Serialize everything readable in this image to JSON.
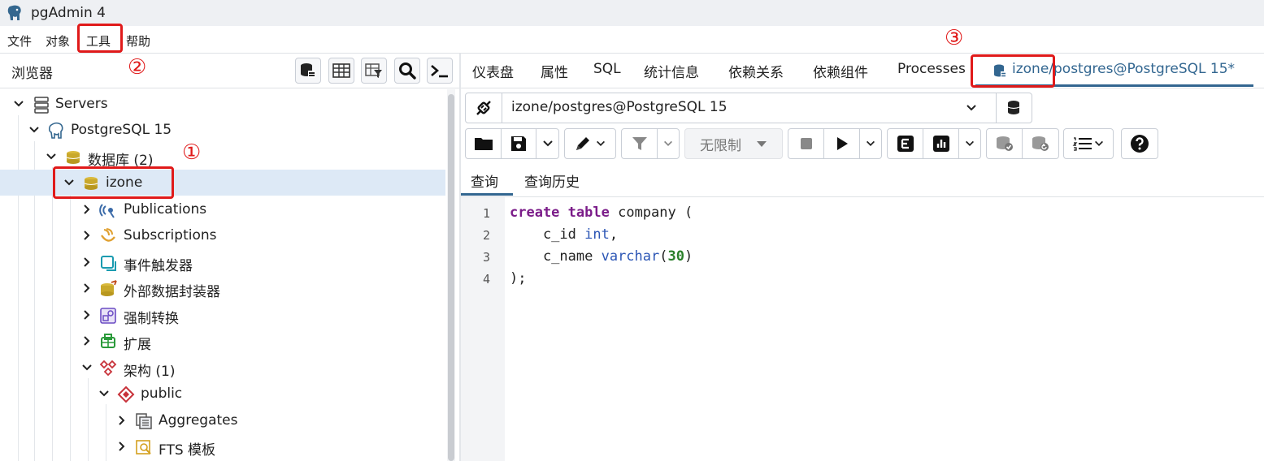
{
  "window": {
    "title": "pgAdmin 4"
  },
  "menu": [
    "文件",
    "对象",
    "工具",
    "帮助"
  ],
  "browser": {
    "title": "浏览器",
    "toolbar_icons": [
      "query-tool-icon",
      "table-view-icon",
      "filtered-rows-icon",
      "search-icon",
      "psql-terminal-icon"
    ]
  },
  "tree": [
    {
      "label": "Servers",
      "icon": "servers-icon"
    },
    {
      "label": "PostgreSQL 15",
      "icon": "elephant-icon"
    },
    {
      "label": "数据库 (2)",
      "icon": "databases-icon"
    },
    {
      "label": "izone",
      "icon": "database-icon",
      "selected": true
    },
    {
      "label": "Publications",
      "icon": "publication-icon"
    },
    {
      "label": "Subscriptions",
      "icon": "subscription-icon"
    },
    {
      "label": "事件触发器",
      "icon": "event-trigger-icon"
    },
    {
      "label": "外部数据封装器",
      "icon": "fdw-icon"
    },
    {
      "label": "强制转换",
      "icon": "cast-icon"
    },
    {
      "label": "扩展",
      "icon": "extension-icon"
    },
    {
      "label": "架构 (1)",
      "icon": "schemas-icon"
    },
    {
      "label": "public",
      "icon": "schema-icon"
    },
    {
      "label": "Aggregates",
      "icon": "aggregate-icon"
    },
    {
      "label": "FTS 模板",
      "icon": "fts-template-icon"
    }
  ],
  "tabs": [
    "仪表盘",
    "属性",
    "SQL",
    "统计信息",
    "依赖关系",
    "依赖组件",
    "Processes",
    "izone/postgres@PostgreSQL 15*"
  ],
  "connection": {
    "value": "izone/postgres@PostgreSQL 15"
  },
  "toolbar": {
    "limit_label": "无限制"
  },
  "query_tabs": [
    "查询",
    "查询历史"
  ],
  "editor": {
    "line_numbers": [
      "1",
      "2",
      "3",
      "4"
    ],
    "lines": [
      [
        [
          "kw",
          "create"
        ],
        [
          "",
          " "
        ],
        [
          "kw",
          "table"
        ],
        [
          "",
          " company ("
        ]
      ],
      [
        [
          "",
          "    c_id "
        ],
        [
          "ty",
          "int"
        ],
        [
          "",
          ","
        ]
      ],
      [
        [
          "",
          "    c_name "
        ],
        [
          "ty",
          "varchar"
        ],
        [
          "",
          "("
        ],
        [
          "num",
          "30"
        ],
        [
          "",
          ")"
        ]
      ],
      [
        [
          "",
          ");"
        ]
      ]
    ]
  },
  "annotations": [
    "①",
    "②",
    "③"
  ],
  "colors": {
    "accent": "#326690",
    "annotation_red": "#e01a1a",
    "selected_row": "#dde9f6"
  }
}
